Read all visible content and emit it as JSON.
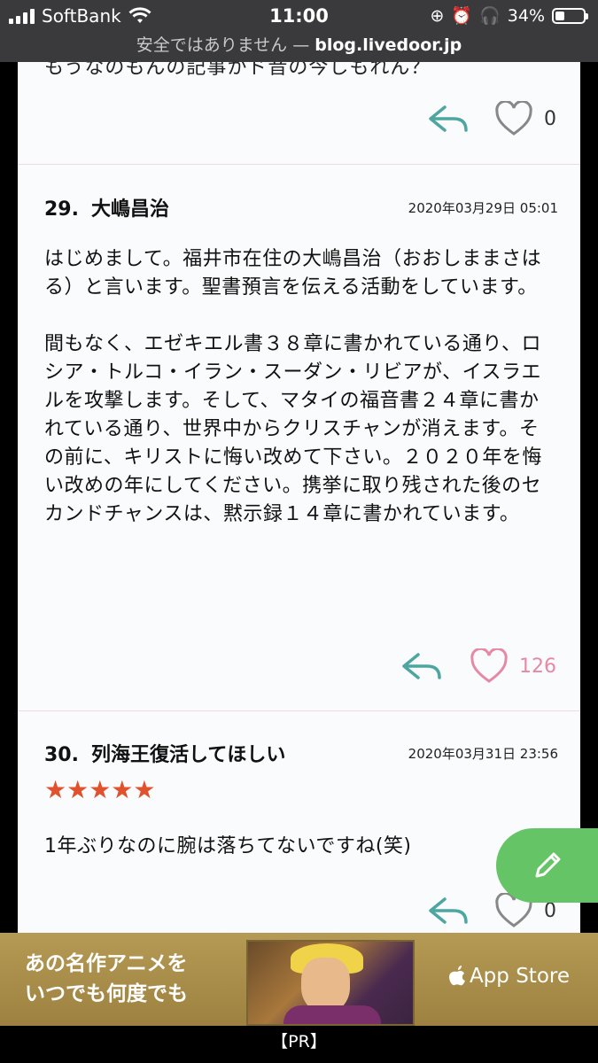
{
  "status_bar": {
    "carrier": "SoftBank",
    "time": "11:00",
    "battery": "34%",
    "battery_level": 0.34,
    "security_note": "安全ではありません — ",
    "domain": "blog.livedoor.jp"
  },
  "top_comment": {
    "cut_text": "もうなのもんの記事かド音の今しもれん？",
    "likes": "0"
  },
  "comments": [
    {
      "number": "29.",
      "author": "大嶋昌治",
      "date": "2020年03月29日 05:01",
      "body": "はじめまして。福井市在住の大嶋昌治（おおしままさはる）と言います。聖書預言を伝える活動をしています。\n\n間もなく、エゼキエル書３８章に書かれている通り、ロシア・トルコ・イラン・スーダン・リビアが、イスラエルを攻撃します。そして、マタイの福音書２４章に書かれている通り、世界中からクリスチャンが消えます。その前に、キリストに悔い改めて下さい。２０２０年を悔い改めの年にしてください。携挙に取り残された後のセカンドチャンスは、黙示録１４章に書かれています。",
      "likes": "126"
    },
    {
      "number": "30.",
      "author": "列海王復活してほしい",
      "date": "2020年03月31日 23:56",
      "rating": 5,
      "stars": "★★★★★",
      "body": "1年ぶりなのに腕は落ちてないですね(笑)",
      "likes": "0"
    }
  ],
  "ad": {
    "line1": "あの名作アニメを",
    "line2": "いつでも何度でも",
    "store": "App Store",
    "pr_label": "【PR】"
  },
  "colors": {
    "accent_teal": "#4ea6a0",
    "liked_pink": "#e58aa5",
    "star_red": "#e2512e",
    "fab_green": "#65c466"
  }
}
